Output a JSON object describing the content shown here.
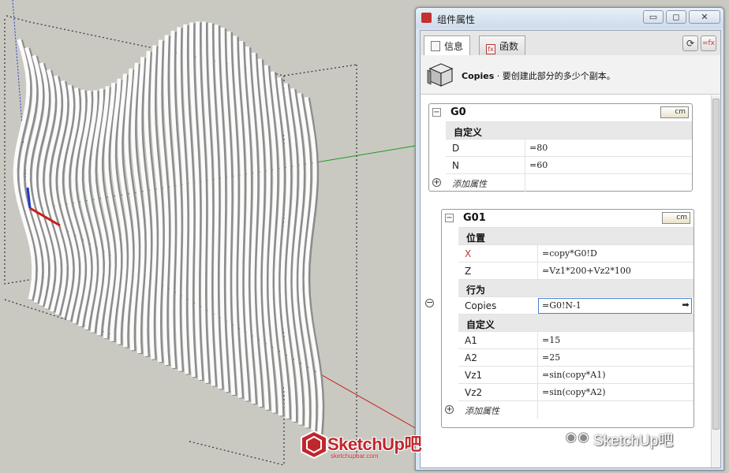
{
  "window": {
    "title": "组件属性",
    "buttons": {
      "minimize": "▭",
      "restore": "◻",
      "close": "✕"
    }
  },
  "tabs": [
    {
      "label": "信息",
      "icon": "info-page-icon"
    },
    {
      "label": "函数",
      "icon": "function-icon"
    }
  ],
  "toolbar": {
    "refresh": "⟳",
    "formula_toggle": "=fx"
  },
  "info": {
    "attribute_name": "Copies",
    "description": " · 要创建此部分的多少个副本。"
  },
  "groups": [
    {
      "name": "G0",
      "unit": "cm",
      "sections": [
        {
          "title": "自定义",
          "rows": [
            {
              "key": "D",
              "value": "=80"
            },
            {
              "key": "N",
              "value": "=60"
            }
          ]
        }
      ],
      "add_label": "添加属性"
    },
    {
      "name": "G01",
      "unit": "cm",
      "sections": [
        {
          "title": "位置",
          "rows": [
            {
              "key": "X",
              "value": "=copy*G0!D",
              "key_color": "#c0392b"
            },
            {
              "key": "Z",
              "value": "=Vz1*200+Vz2*100"
            }
          ]
        },
        {
          "title": "行为",
          "rows": [
            {
              "key": "Copies",
              "value": "=G0!N-1",
              "editing": true
            }
          ]
        },
        {
          "title": "自定义",
          "rows": [
            {
              "key": "A1",
              "value": "=15"
            },
            {
              "key": "A2",
              "value": "=25"
            },
            {
              "key": "Vz1",
              "value": "=sin(copy*A1)"
            },
            {
              "key": "Vz2",
              "value": "=sin(copy*A2)"
            }
          ]
        }
      ],
      "add_label": "添加属性"
    }
  ],
  "logo": {
    "text": "SketchUp吧",
    "url": "sketchupbar.com"
  },
  "watermark": {
    "text": "SketchUp吧"
  },
  "colors": {
    "panel_bg": "#d9e4f1",
    "section_bg": "#e8e8e8",
    "accent_red": "#c0392b",
    "edit_border": "#4c84d1",
    "axis_red": "#c81e1e",
    "axis_green": "#1e9a1e",
    "axis_blue": "#1e3ac8"
  }
}
